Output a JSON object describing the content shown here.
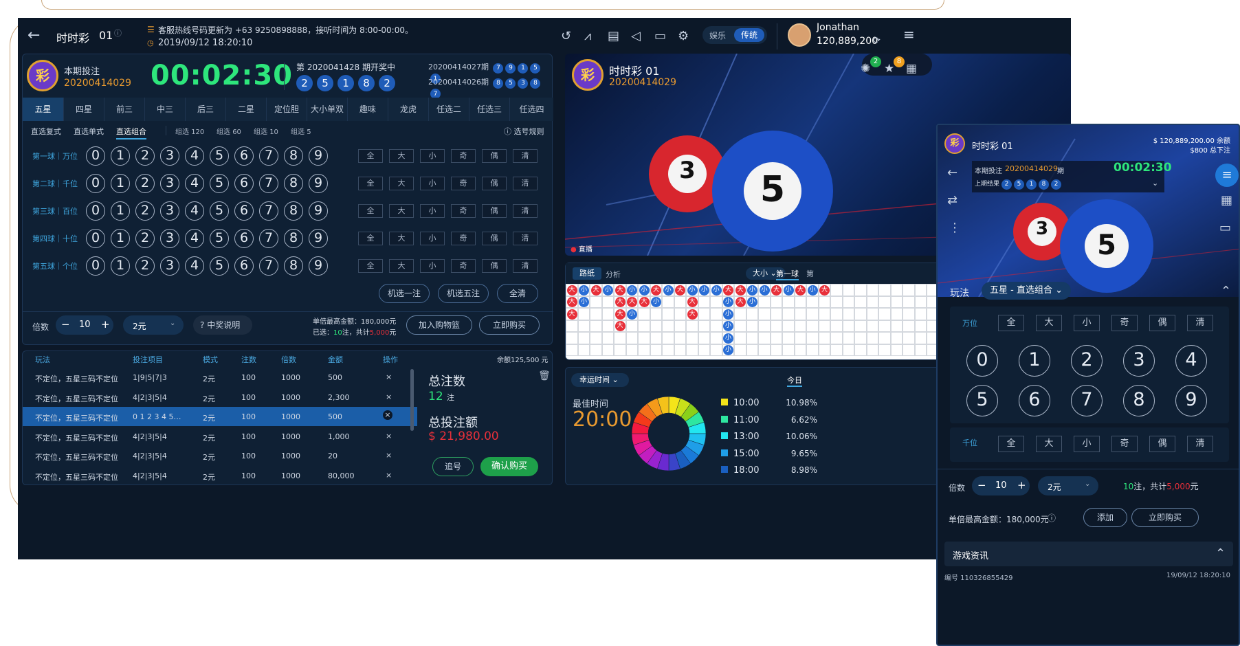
{
  "header": {
    "game_name": "时时彩",
    "game_no": "01",
    "notice": "客服热线号码更新为 +63 9250898888，接听时间为 8:00-00:00。",
    "datetime": "2019/09/12 18:20:10",
    "mode_options": [
      "娱乐",
      "传统"
    ],
    "mode_selected": "传统",
    "username": "Jonathan",
    "balance": "120,889,200",
    "badge_green": "2",
    "badge_orange": "8"
  },
  "period": {
    "label": "本期投注",
    "number": "20200414029",
    "countdown": "00:02:30",
    "drawing_label": "第 2020041428 期开奖中",
    "drawing_balls": [
      "2",
      "5",
      "1",
      "8",
      "2"
    ],
    "history": [
      {
        "period": "20200414027期",
        "balls": [
          "7",
          "9",
          "1",
          "5",
          "1"
        ]
      },
      {
        "period": "20200414026期",
        "balls": [
          "8",
          "5",
          "3",
          "8",
          "7"
        ]
      }
    ]
  },
  "tabs": [
    "五星",
    "四星",
    "前三",
    "中三",
    "后三",
    "二星",
    "定位胆",
    "大小单双",
    "趣味",
    "龙虎",
    "任选二",
    "任选三",
    "任选四"
  ],
  "subtabs": [
    "直选复式",
    "直选单式",
    "直选组合"
  ],
  "subtab_active": "直选组合",
  "groups": [
    {
      "label": "组选",
      "value": "120"
    },
    {
      "label": "组选",
      "value": "60"
    },
    {
      "label": "组选",
      "value": "10"
    },
    {
      "label": "组选",
      "value": "5"
    }
  ],
  "rules_label": "选号规则",
  "rows": [
    {
      "label": "第一球｜万位"
    },
    {
      "label": "第二球｜千位"
    },
    {
      "label": "第三球｜百位"
    },
    {
      "label": "第四球｜十位"
    },
    {
      "label": "第五球｜个位"
    }
  ],
  "digits": [
    "0",
    "1",
    "2",
    "3",
    "4",
    "5",
    "6",
    "7",
    "8",
    "9"
  ],
  "quick": [
    "全",
    "大",
    "小",
    "奇",
    "偶",
    "清"
  ],
  "actions": {
    "random_one": "机选一注",
    "random_five": "机选五注",
    "clear_all": "全清"
  },
  "bet": {
    "multiplier_label": "倍数",
    "multiplier": "10",
    "minus": "−",
    "plus": "+",
    "unit": "2元",
    "prize_info": "中奖说明",
    "max_label": "单倍最高金额：180,000元",
    "selected_prefix": "已选：",
    "selected_count": "10",
    "selected_mid": "注，共计",
    "selected_amount": "5,000",
    "selected_suffix": "元",
    "add_cart": "加入购物篮",
    "buy_now": "立即购买"
  },
  "table": {
    "headers": [
      "玩法",
      "投注项目",
      "模式",
      "注数",
      "倍数",
      "金额",
      "操作"
    ],
    "balance_label": "余额125,500 元",
    "rows": [
      [
        "不定位，五星三码不定位",
        "1|9|5|7|3",
        "2元",
        "100",
        "1000",
        "500"
      ],
      [
        "不定位，五星三码不定位",
        "4|2|3|5|4",
        "2元",
        "100",
        "1000",
        "2,300"
      ],
      [
        "不定位，五星三码不定位",
        "0 1 2 3 4 5…",
        "2元",
        "100",
        "1000",
        "500"
      ],
      [
        "不定位，五星三码不定位",
        "4|2|3|5|4",
        "2元",
        "100",
        "1000",
        "1,000"
      ],
      [
        "不定位，五星三码不定位",
        "4|2|3|5|4",
        "2元",
        "100",
        "1000",
        "20"
      ],
      [
        "不定位，五星三码不定位",
        "4|2|3|5|4",
        "2元",
        "100",
        "1000",
        "80,000"
      ]
    ],
    "delete_mark": "×"
  },
  "summary": {
    "total_bets_label": "总注数",
    "total_bets": "12",
    "bets_unit": "注",
    "total_amount_label": "总投注额",
    "total_amount": "$ 21,980.00",
    "chase": "追号",
    "confirm": "确认购买"
  },
  "video": {
    "title": "时时彩 01",
    "period": "20200414029",
    "live": "直播",
    "ball_numbers": [
      "3",
      "5"
    ]
  },
  "roadmap": {
    "tabs": [
      "路纸",
      "分析"
    ],
    "filter": "大小",
    "ball_tabs": [
      "第一球",
      "第"
    ],
    "big": "大",
    "small": "小"
  },
  "lucky": {
    "label": "幸运时间",
    "today": "今日",
    "best_label": "最佳时间",
    "best_time": "20:00",
    "items": [
      {
        "time": "10:00",
        "pct": "10.98%",
        "color": "#f4e41a"
      },
      {
        "time": "11:00",
        "pct": "6.62%",
        "color": "#2ee6a0"
      },
      {
        "time": "13:00",
        "pct": "10.06%",
        "color": "#22e6f0"
      },
      {
        "time": "15:00",
        "pct": "9.65%",
        "color": "#1f9ee8"
      },
      {
        "time": "18:00",
        "pct": "8.98%",
        "color": "#1a5fc0"
      }
    ]
  },
  "mobile": {
    "title": "时时彩 01",
    "balance": "$ 120,889,200.00",
    "balance_label": "余额",
    "bet_total": "$800",
    "bet_total_label": "总下注",
    "period_label": "本期投注",
    "period": "20200414029",
    "period_suffix": "期",
    "countdown": "00:02:30",
    "last_label": "上期结果",
    "last_balls": [
      "2",
      "5",
      "1",
      "8",
      "2"
    ],
    "play_label": "玩法",
    "play_value": "五星 - 直选组合",
    "row1": "万位",
    "row2": "千位",
    "multiplier_label": "倍数",
    "multiplier": "10",
    "unit": "2元",
    "count": "10",
    "count_mid": "注，共计",
    "amount": "5,000",
    "amount_suffix": "元",
    "max_label": "单倍最高金额：180,000元",
    "add": "添加",
    "buy": "立即购买",
    "info_label": "游戏资讯",
    "serial": "编号 110326855429",
    "info_time": "19/09/12 18:20:10"
  }
}
